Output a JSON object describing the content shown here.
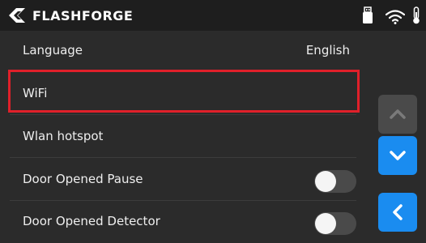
{
  "header": {
    "brand": "FLASHFORGE",
    "icons": [
      "flashforge-logo-icon",
      "usb-drive-icon",
      "wifi-icon",
      "thermometer-icon"
    ]
  },
  "settings": {
    "items": [
      {
        "label": "Language",
        "value": "English"
      },
      {
        "label": "WiFi"
      },
      {
        "label": "Wlan hotspot"
      },
      {
        "label": "Door Opened Pause",
        "toggle": false
      },
      {
        "label": "Door Opened Detector",
        "toggle": false
      }
    ]
  },
  "navigation": {
    "icons": [
      "chevron-up-icon",
      "chevron-down-icon",
      "chevron-left-icon"
    ],
    "up_enabled": false
  },
  "colors": {
    "accent": "#1a8cf0",
    "highlight": "#e0202a",
    "background": "#2b2b2b",
    "topbar": "#1e1e1e",
    "disabled_button": "#4a4a4a"
  }
}
